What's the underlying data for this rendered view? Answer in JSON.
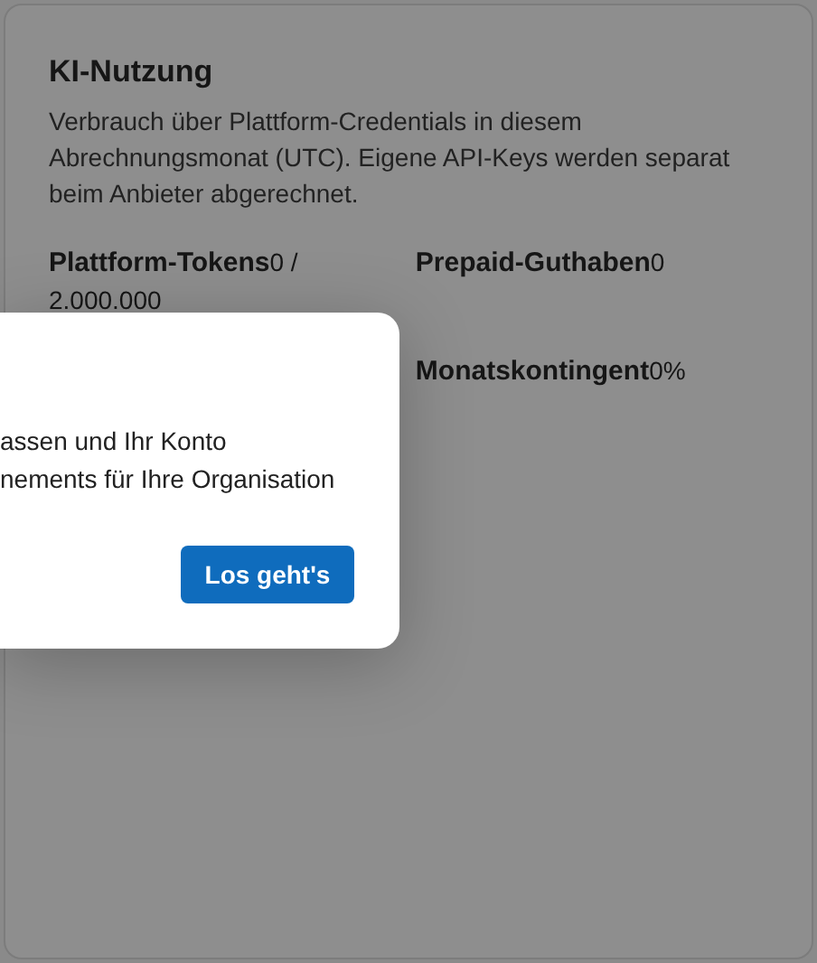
{
  "card": {
    "title": "KI-Nutzung",
    "description": "Verbrauch über Plattform-Credentials in diesem Abrechnungsmonat (UTC). Eigene API-Keys werden separat beim Anbieter abgerechnet.",
    "left_stats": [
      {
        "label": "Plattform-Tokens",
        "value": "0 / 2.000.000"
      }
    ],
    "right_stats": [
      {
        "label": "Prepaid-Guthaben",
        "value": "0"
      },
      {
        "label": "Monatskontingent",
        "value": "0%"
      }
    ]
  },
  "dialog": {
    "lines": [
      "assen und Ihr Konto",
      "nements für Ihre Organisation"
    ],
    "button": "Los geht's"
  }
}
